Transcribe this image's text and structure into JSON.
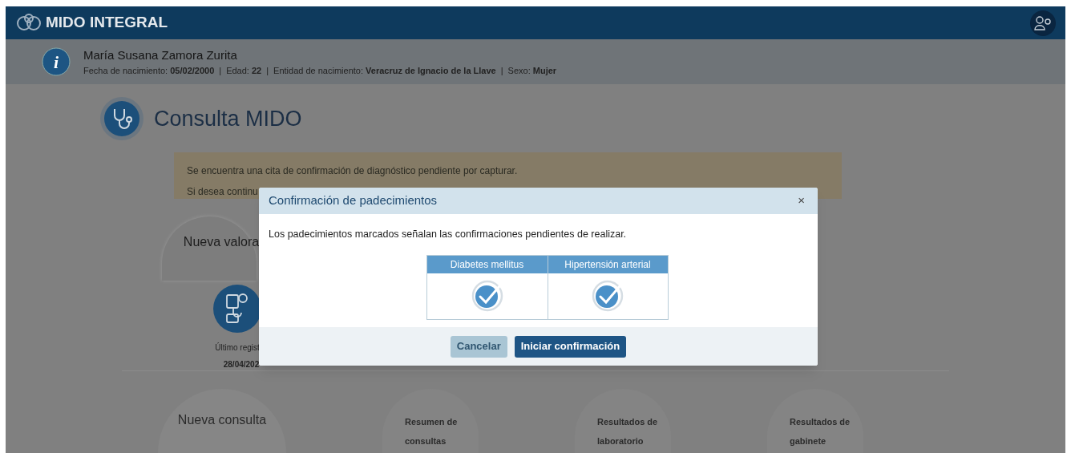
{
  "header": {
    "brand": "MIDO INTEGRAL"
  },
  "patient": {
    "info_glyph": "i",
    "separator": "|",
    "name": "María Susana Zamora Zurita",
    "fields": [
      {
        "label": "Fecha de nacimiento:",
        "value": "05/02/2000"
      },
      {
        "label": "Edad:",
        "value": "22"
      },
      {
        "label": "Entidad de nacimiento:",
        "value": "Veracruz de Ignacio de la Llave"
      },
      {
        "label": "Sexo:",
        "value": "Mujer"
      }
    ]
  },
  "page_title": "Consulta MIDO",
  "alert": {
    "lines": [
      "Se encuentra una cita de confirmación de diagnóstico pendiente por capturar.",
      "Si desea continu"
    ]
  },
  "valoracion_card": {
    "title": "Nueva valora",
    "caption": "Último regist",
    "date": "28/04/202"
  },
  "bottom_cards": [
    {
      "title": "Nueva consulta",
      "kind": "large"
    },
    {
      "title": "Resumen de consultas",
      "kind": "small"
    },
    {
      "title": "Resultados de laboratorio",
      "kind": "small"
    },
    {
      "title": "Resultados de gabinete",
      "kind": "small"
    }
  ],
  "modal": {
    "title": "Confirmación de padecimientos",
    "close": "×",
    "message": "Los padecimientos marcados señalan las confirmaciones pendientes de realizar.",
    "conditions": [
      {
        "name": "Diabetes mellitus",
        "checked": true
      },
      {
        "name": "Hipertensión arterial",
        "checked": true
      }
    ],
    "buttons": [
      {
        "label": "Cancelar",
        "disabled": true
      },
      {
        "label": "Iniciar confirmación",
        "disabled": false
      }
    ]
  }
}
